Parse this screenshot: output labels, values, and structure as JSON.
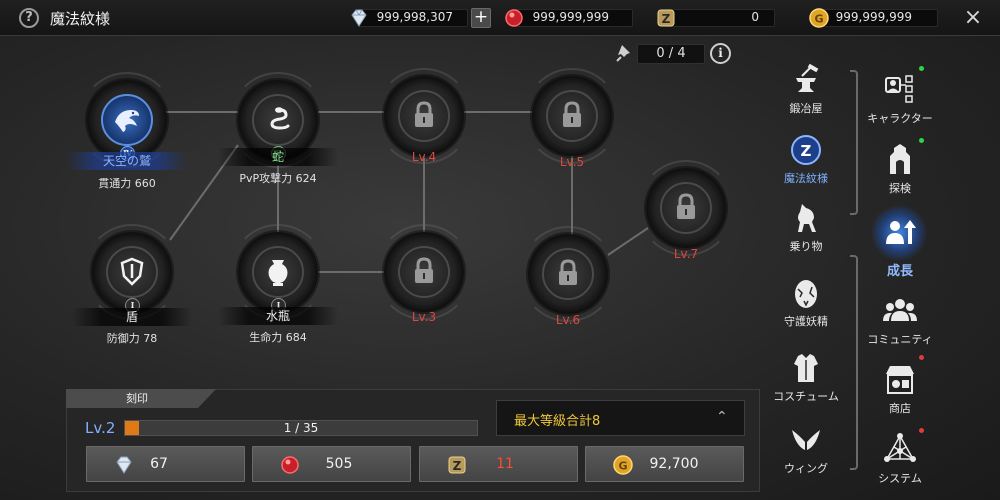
{
  "header": {
    "help_icon": "?",
    "title": "魔法紋様",
    "close_icon": "×",
    "plus_label": "+",
    "currencies": [
      {
        "icon": "diamond-icon",
        "value": "999,998,307"
      },
      {
        "icon": "red-gem-icon",
        "value": "999,999,999"
      },
      {
        "icon": "z-token-icon",
        "value": "0"
      },
      {
        "icon": "gold-coin-icon",
        "value": "999,999,999"
      }
    ]
  },
  "pins": {
    "counter": "0 / 4",
    "info_icon": "i"
  },
  "tree": {
    "nodes": [
      {
        "name": "天空の鷲",
        "tier": "Ⅳ",
        "stat": "貫通力 660",
        "icon": "eagle-icon"
      },
      {
        "name": "蛇",
        "tier": "Ⅱ",
        "stat": "PvP攻撃力 624",
        "icon": "snake-icon"
      },
      {
        "name": "盾",
        "tier": "Ⅰ",
        "stat": "防御力 78",
        "icon": "shield-icon"
      },
      {
        "name": "水瓶",
        "tier": "Ⅰ",
        "stat": "生命力 684",
        "icon": "vase-icon"
      }
    ],
    "locked": [
      {
        "label": "Lv.4"
      },
      {
        "label": "Lv.5"
      },
      {
        "label": "Lv.3"
      },
      {
        "label": "Lv.6"
      },
      {
        "label": "Lv.7"
      }
    ]
  },
  "engrave": {
    "tab_label": "刻印",
    "level": "Lv.2",
    "progress_text": "1 / 35",
    "progress_fraction": 0.0286,
    "dropdown_text": "最大等級合計8",
    "dropdown_chevron": "⌃",
    "costs": [
      {
        "icon": "diamond-icon",
        "value": "67",
        "insufficient": false
      },
      {
        "icon": "red-gem-icon",
        "value": "505",
        "insufficient": false
      },
      {
        "icon": "z-token-icon",
        "value": "11",
        "insufficient": true
      },
      {
        "icon": "gold-coin-icon",
        "value": "92,700",
        "insufficient": false
      }
    ]
  },
  "submenu": [
    {
      "label": "鍛冶屋",
      "icon": "anvil-icon"
    },
    {
      "label": "魔法紋様",
      "icon": "magic-rune-icon",
      "selected": true
    },
    {
      "label": "乗り物",
      "icon": "horse-icon"
    },
    {
      "label": "守護妖精",
      "icon": "egg-icon"
    },
    {
      "label": "コスチューム",
      "icon": "armor-icon"
    },
    {
      "label": "ウィング",
      "icon": "wings-icon"
    }
  ],
  "mainmenu": [
    {
      "label": "キャラクター",
      "icon": "character-icon",
      "dot": "#2fd34a"
    },
    {
      "label": "探検",
      "icon": "explore-icon",
      "dot": "#2fd34a"
    },
    {
      "label": "成長",
      "icon": "growth-icon",
      "selected": true
    },
    {
      "label": "コミュニティ",
      "icon": "community-icon"
    },
    {
      "label": "商店",
      "icon": "shop-icon",
      "dot": "#e23a3a"
    },
    {
      "label": "システム",
      "icon": "system-icon",
      "dot": "#e23a3a"
    }
  ],
  "colors": {
    "accent": "#7fb0ff",
    "locked_level": "#e0473f",
    "progress": "#e07a16",
    "dropdown_text": "#f0c63a"
  }
}
